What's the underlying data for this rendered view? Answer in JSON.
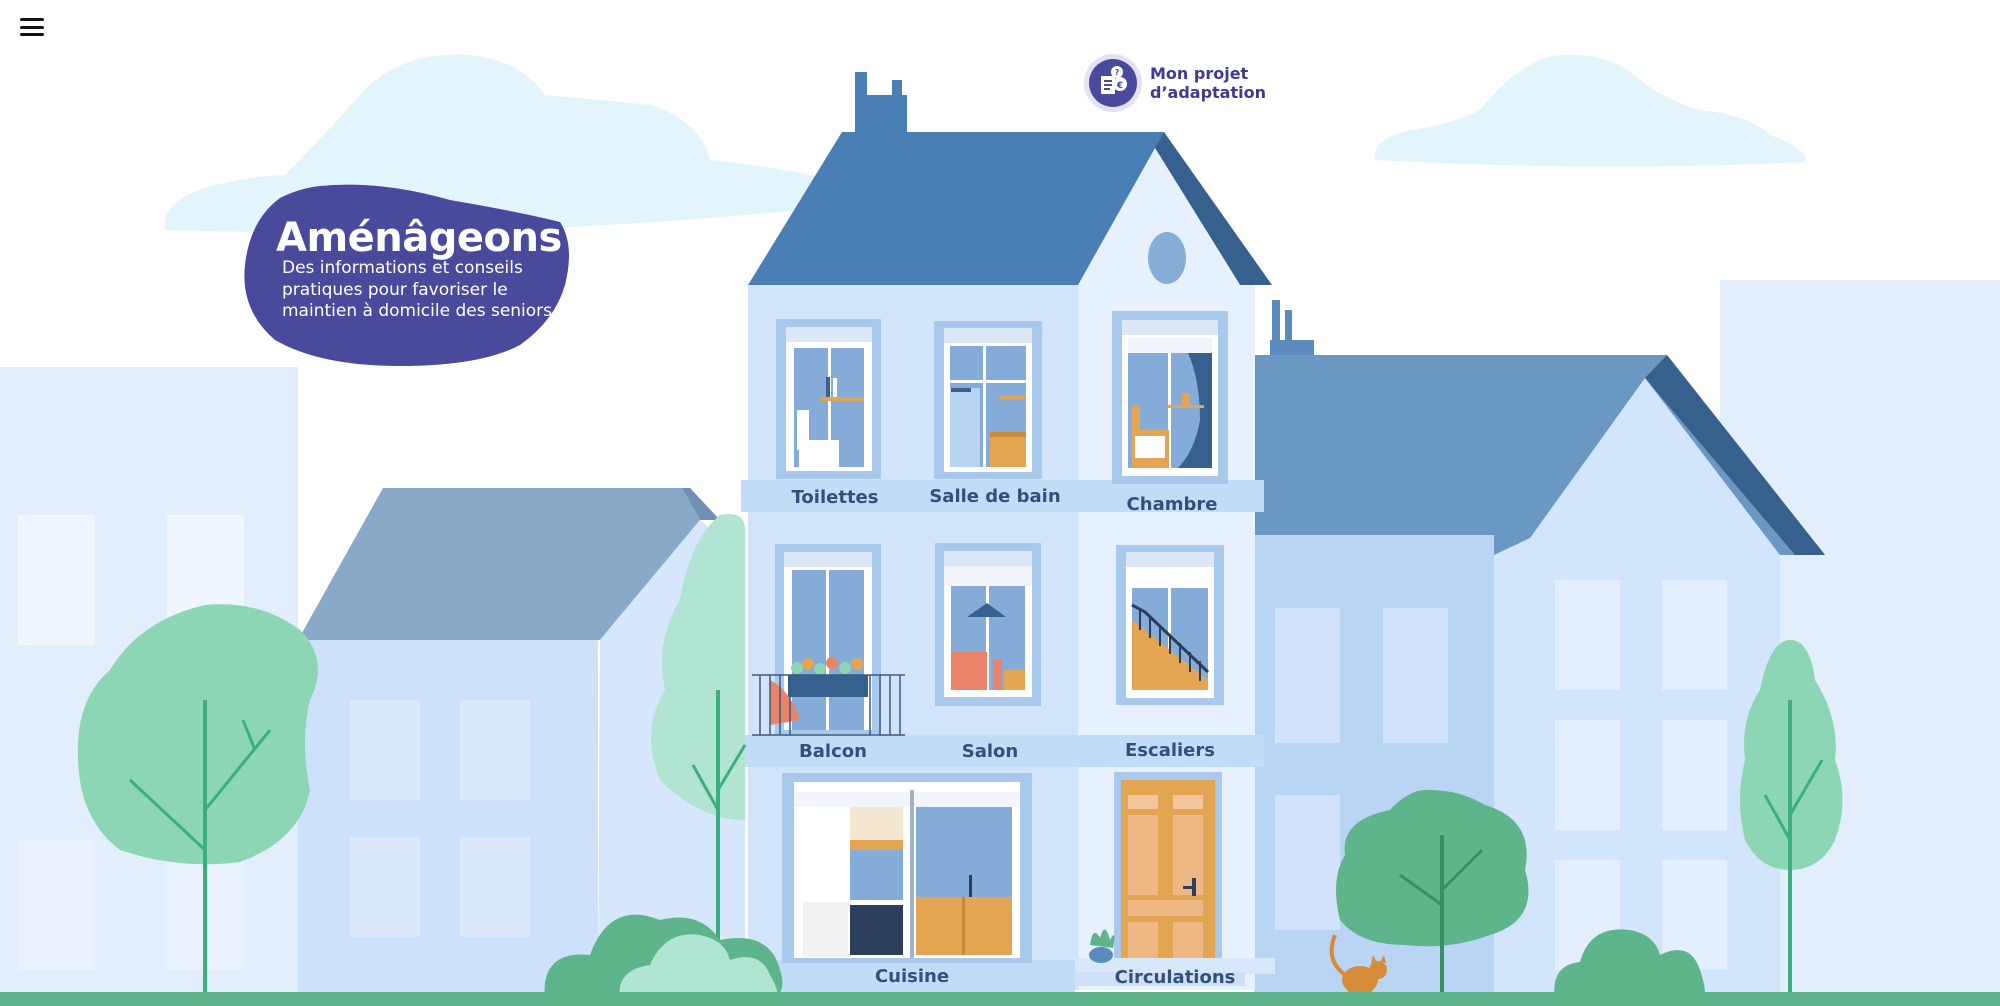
{
  "header": {
    "menu_icon": "hamburger-menu-icon",
    "project_link": {
      "label": "Mon projet\nd’adaptation",
      "icon": "document-euro-icon"
    }
  },
  "intro": {
    "title": "Aménâgeons",
    "subtitle": "Des informations et conseils pratiques pour favoriser le maintien à domicile des seniors",
    "blob_color": "#4a4a9c"
  },
  "rooms": [
    {
      "id": "toilettes",
      "label": "Toilettes"
    },
    {
      "id": "salle-de-bain",
      "label": "Salle de bain"
    },
    {
      "id": "chambre",
      "label": "Chambre"
    },
    {
      "id": "balcon",
      "label": "Balcon"
    },
    {
      "id": "salon",
      "label": "Salon"
    },
    {
      "id": "escaliers",
      "label": "Escaliers"
    },
    {
      "id": "cuisine",
      "label": "Cuisine"
    },
    {
      "id": "circulations",
      "label": "Circulations"
    }
  ],
  "colors": {
    "roof": "#4a7fb5",
    "facade": "#d6e6fb",
    "ground": "#5eb58c",
    "tree": "#8dd6b5",
    "label": "#33507a"
  }
}
